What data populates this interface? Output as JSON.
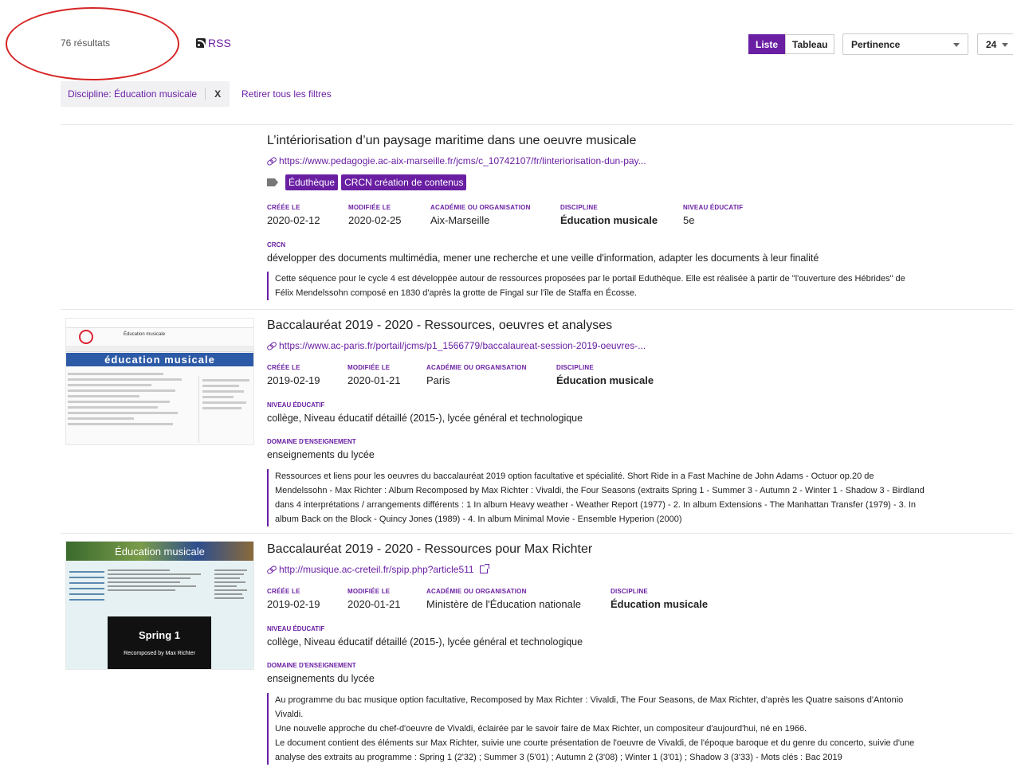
{
  "toolbar": {
    "results_count": "76 résultats",
    "rss_label": "RSS",
    "view_list": "Liste",
    "view_table": "Tableau",
    "sort_selected": "Pertinence",
    "per_page_selected": "24"
  },
  "filters": {
    "active_filter": "Discipline: Éducation musicale",
    "remove_chip": "X",
    "clear_all": "Retirer tous les filtres"
  },
  "labels": {
    "created": "CRÉÉE LE",
    "modified": "MODIFIÉE LE",
    "academy": "ACADÉMIE OU ORGANISATION",
    "discipline": "DISCIPLINE",
    "level": "NIVEAU ÉDUCATIF",
    "crcn": "CRCN",
    "domain": "DOMAINE D'ENSEIGNEMENT"
  },
  "results": [
    {
      "title": "L’intériorisation d’un paysage maritime dans une oeuvre musicale",
      "url": "https://www.pedagogie.ac-aix-marseille.fr/jcms/c_10742107/fr/linteriorisation-dun-pay...",
      "tags": [
        "Éduthèque",
        "CRCN création de contenus"
      ],
      "created": "2020-02-12",
      "modified": "2020-02-25",
      "academy": "Aix-Marseille",
      "discipline": "Éducation musicale",
      "level": "5e",
      "crcn": "développer des documents multimédia, mener une recherche et une veille d'information, adapter les documents à leur finalité",
      "description": [
        "Cette séquence pour le cycle 4 est développée autour de ressources proposées par le portail Eduthèque. Elle est réalisée à partir de \"l'ouverture des Hébrides\" de",
        "Félix Mendelssohn composé en 1830 d'après la grotte de Fingal sur l'île de Staffa en Écosse."
      ]
    },
    {
      "title": "Baccalauréat 2019 - 2020 - Ressources, oeuvres et analyses",
      "url": "https://www.ac-paris.fr/portail/jcms/p1_1566779/baccalaureat-session-2019-oeuvres-...",
      "created": "2019-02-19",
      "modified": "2020-01-21",
      "academy": "Paris",
      "discipline": "Éducation musicale",
      "level": "collège, Niveau éducatif détaillé (2015-), lycée général et technologique",
      "domain": "enseignements du lycée",
      "description": [
        "Ressources et liens pour les oeuvres du baccalauréat 2019 option facultative et spécialité. Short Ride in a Fast Machine de John Adams - Octuor op.20 de",
        "Mendelssohn - Max Richter : Album Recomposed by Max Richter : Vivaldi, the Four Seasons (extraits Spring 1 - Summer 3 - Autumn 2 - Winter 1 - Shadow 3 - Birdland",
        "dans 4 interprétations / arrangements différents : 1 In album Heavy weather - Weather Report (1977) - 2. In album Extensions - The Manhattan Transfer (1979) - 3. In",
        "album Back on the Block - Quincy Jones (1989) - 4. In album Minimal Movie - Ensemble Hyperion (2000)"
      ],
      "thumb": {
        "site_title": "Éducation musicale",
        "banner": "éducation musicale"
      }
    },
    {
      "title": "Baccalauréat 2019 - 2020 - Ressources pour Max Richter",
      "url": "http://musique.ac-creteil.fr/spip.php?article511",
      "created": "2019-02-19",
      "modified": "2020-01-21",
      "academy": "Ministère de l'Éducation nationale",
      "discipline": "Éducation musicale",
      "level": "collège, Niveau éducatif détaillé (2015-), lycée général et technologique",
      "domain": "enseignements du lycée",
      "description": [
        "Au programme du bac musique option facultative, Recomposed by Max Richter : Vivaldi, The Four Seasons, de Max Richter, d'après les Quatre saisons d'Antonio",
        "Vivaldi.",
        "Une nouvelle approche du chef-d'oeuvre de Vivaldi, éclairée par le savoir faire de Max Richter, un compositeur d'aujourd'hui, né en 1966.",
        "Le document contient des éléments sur Max Richter, suivie une courte présentation de l'oeuvre de Vivaldi, de l'époque baroque et du genre du concerto, suivie d'une",
        "analyse des extraits au programme : Spring 1 (2'32) ; Summer 3 (5'01) ; Autumn 2 (3'08) ; Winter 1 (3'01) ; Shadow 3 (3'33) - Mots clés : Bac 2019"
      ],
      "thumb": {
        "banner": "Éducation musicale",
        "video_title": "Spring 1",
        "video_sub": "Recomposed by Max Richter"
      }
    }
  ],
  "colors": {
    "accent": "#6a1fa3",
    "annotation_circle": "#d62424"
  }
}
